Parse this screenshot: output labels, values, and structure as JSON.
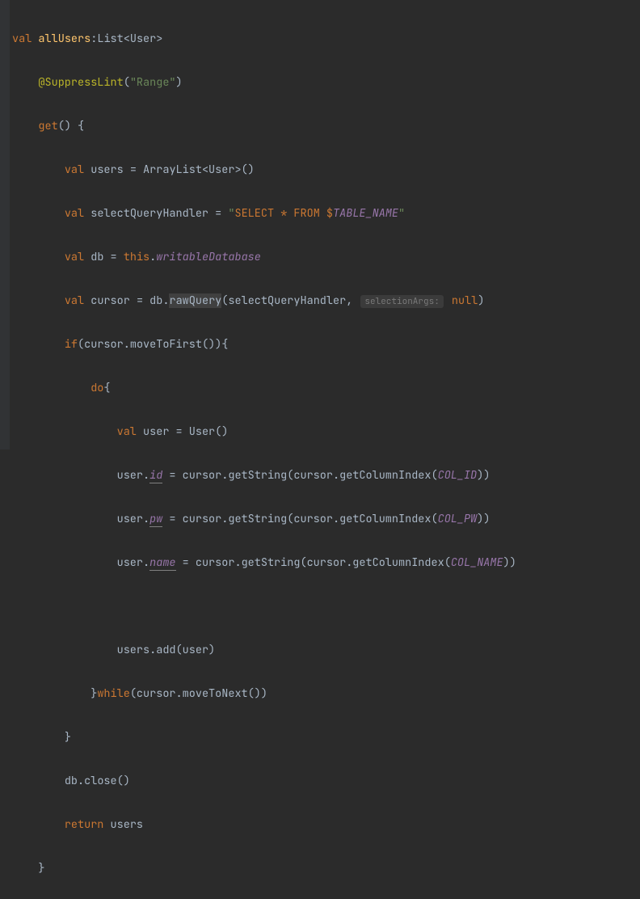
{
  "lines": {
    "l1": {
      "kw_val": "val",
      "name": "allUsers",
      "colon": ":",
      "type": "List<User>"
    },
    "l2": {
      "annotation": "@SuppressLint",
      "paren_open": "(",
      "string": "\"Range\"",
      "paren_close": ")"
    },
    "l3": {
      "kw_get": "get",
      "parens": "() {"
    },
    "l4": {
      "kw_val": "val",
      "name": "users",
      "eq": " = ",
      "call": "ArrayList<User>()"
    },
    "l5": {
      "kw_val": "val",
      "name": "selectQueryHandler",
      "eq": " = ",
      "q1": "\"",
      "s1": "SELECT",
      "sp1": " ",
      "s2": "*",
      "sp2": " ",
      "s3": "FROM",
      "sp3": " ",
      "dollar": "$",
      "tbl": "TABLE_NAME",
      "q2": "\""
    },
    "l6": {
      "kw_val": "val",
      "name": "db",
      "eq": " = ",
      "this": "this",
      "dot": ".",
      "prop": "writableDatabase"
    },
    "l7": {
      "kw_val": "val",
      "name": "cursor",
      "eq": " = ",
      "obj": "db",
      "dot1": ".",
      "method": "rawQuery",
      "po": "(",
      "arg1": "selectQueryHandler",
      "comma": ", ",
      "hint": "selectionArgs:",
      "null": "null",
      "pc": ")"
    },
    "l8": {
      "kw_if": "if",
      "po": "(",
      "obj": "cursor",
      "dot": ".",
      "method": "moveToFirst",
      "pc": "()){"
    },
    "l9": {
      "kw_do": "do",
      "brace": "{"
    },
    "l10": {
      "kw_val": "val",
      "name": "user",
      "eq": " = ",
      "call": "User()"
    },
    "l11": {
      "obj": "user",
      "dot": ".",
      "prop": "id",
      "eq": " = ",
      "obj2": "cursor",
      "dot2": ".",
      "m1": "getString",
      "po1": "(",
      "obj3": "cursor",
      "dot3": ".",
      "m2": "getColumnIndex",
      "po2": "(",
      "const": "COL_ID",
      "pc": "))"
    },
    "l12": {
      "obj": "user",
      "dot": ".",
      "prop": "pw",
      "eq": " = ",
      "obj2": "cursor",
      "dot2": ".",
      "m1": "getString",
      "po1": "(",
      "obj3": "cursor",
      "dot3": ".",
      "m2": "getColumnIndex",
      "po2": "(",
      "const": "COL_PW",
      "pc": "))"
    },
    "l13": {
      "obj": "user",
      "dot": ".",
      "prop": "name",
      "eq": " = ",
      "obj2": "cursor",
      "dot2": ".",
      "m1": "getString",
      "po1": "(",
      "obj3": "cursor",
      "dot3": ".",
      "m2": "getColumnIndex",
      "po2": "(",
      "const": "COL_NAME",
      "pc": "))"
    },
    "l14": {
      "blank": ""
    },
    "l15": {
      "obj": "users",
      "dot": ".",
      "method": "add",
      "po": "(",
      "arg": "user",
      "pc": ")"
    },
    "l16": {
      "brace": "}",
      "kw_while": "while",
      "po": "(",
      "obj": "cursor",
      "dot": ".",
      "method": "moveToNext",
      "pc": "())"
    },
    "l17": {
      "brace": "}"
    },
    "l18": {
      "obj": "db",
      "dot": ".",
      "method": "close",
      "pc": "()"
    },
    "l19": {
      "kw_return": "return",
      "sp": " ",
      "name": "users"
    },
    "l20": {
      "brace": "}"
    }
  }
}
